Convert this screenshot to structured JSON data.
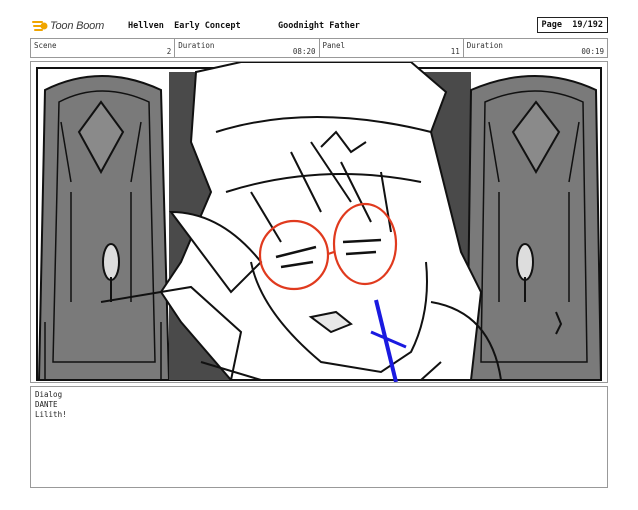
{
  "header": {
    "logo_text": "Toon Boom",
    "project_name": "Hellven",
    "project_subtitle": "Early Concept",
    "sequence_title": "Goodnight Father",
    "page_label": "Page",
    "page_value": "19/192"
  },
  "info": [
    {
      "label": "Scene",
      "value": "2"
    },
    {
      "label": "Duration",
      "value": "08:20"
    },
    {
      "label": "Panel",
      "value": "11"
    },
    {
      "label": "Duration",
      "value": "00:19"
    }
  ],
  "panel": {
    "description": "",
    "colors": {
      "glasses": "#e03a1e",
      "pen": "#1a1ae0",
      "door": "#7a7a7a",
      "dark": "#3c3c3c"
    }
  },
  "dialog": {
    "label": "Dialog",
    "character": "DANTE",
    "line": "Lilith!"
  },
  "icons": [
    "toon-boom-logo-icon"
  ]
}
